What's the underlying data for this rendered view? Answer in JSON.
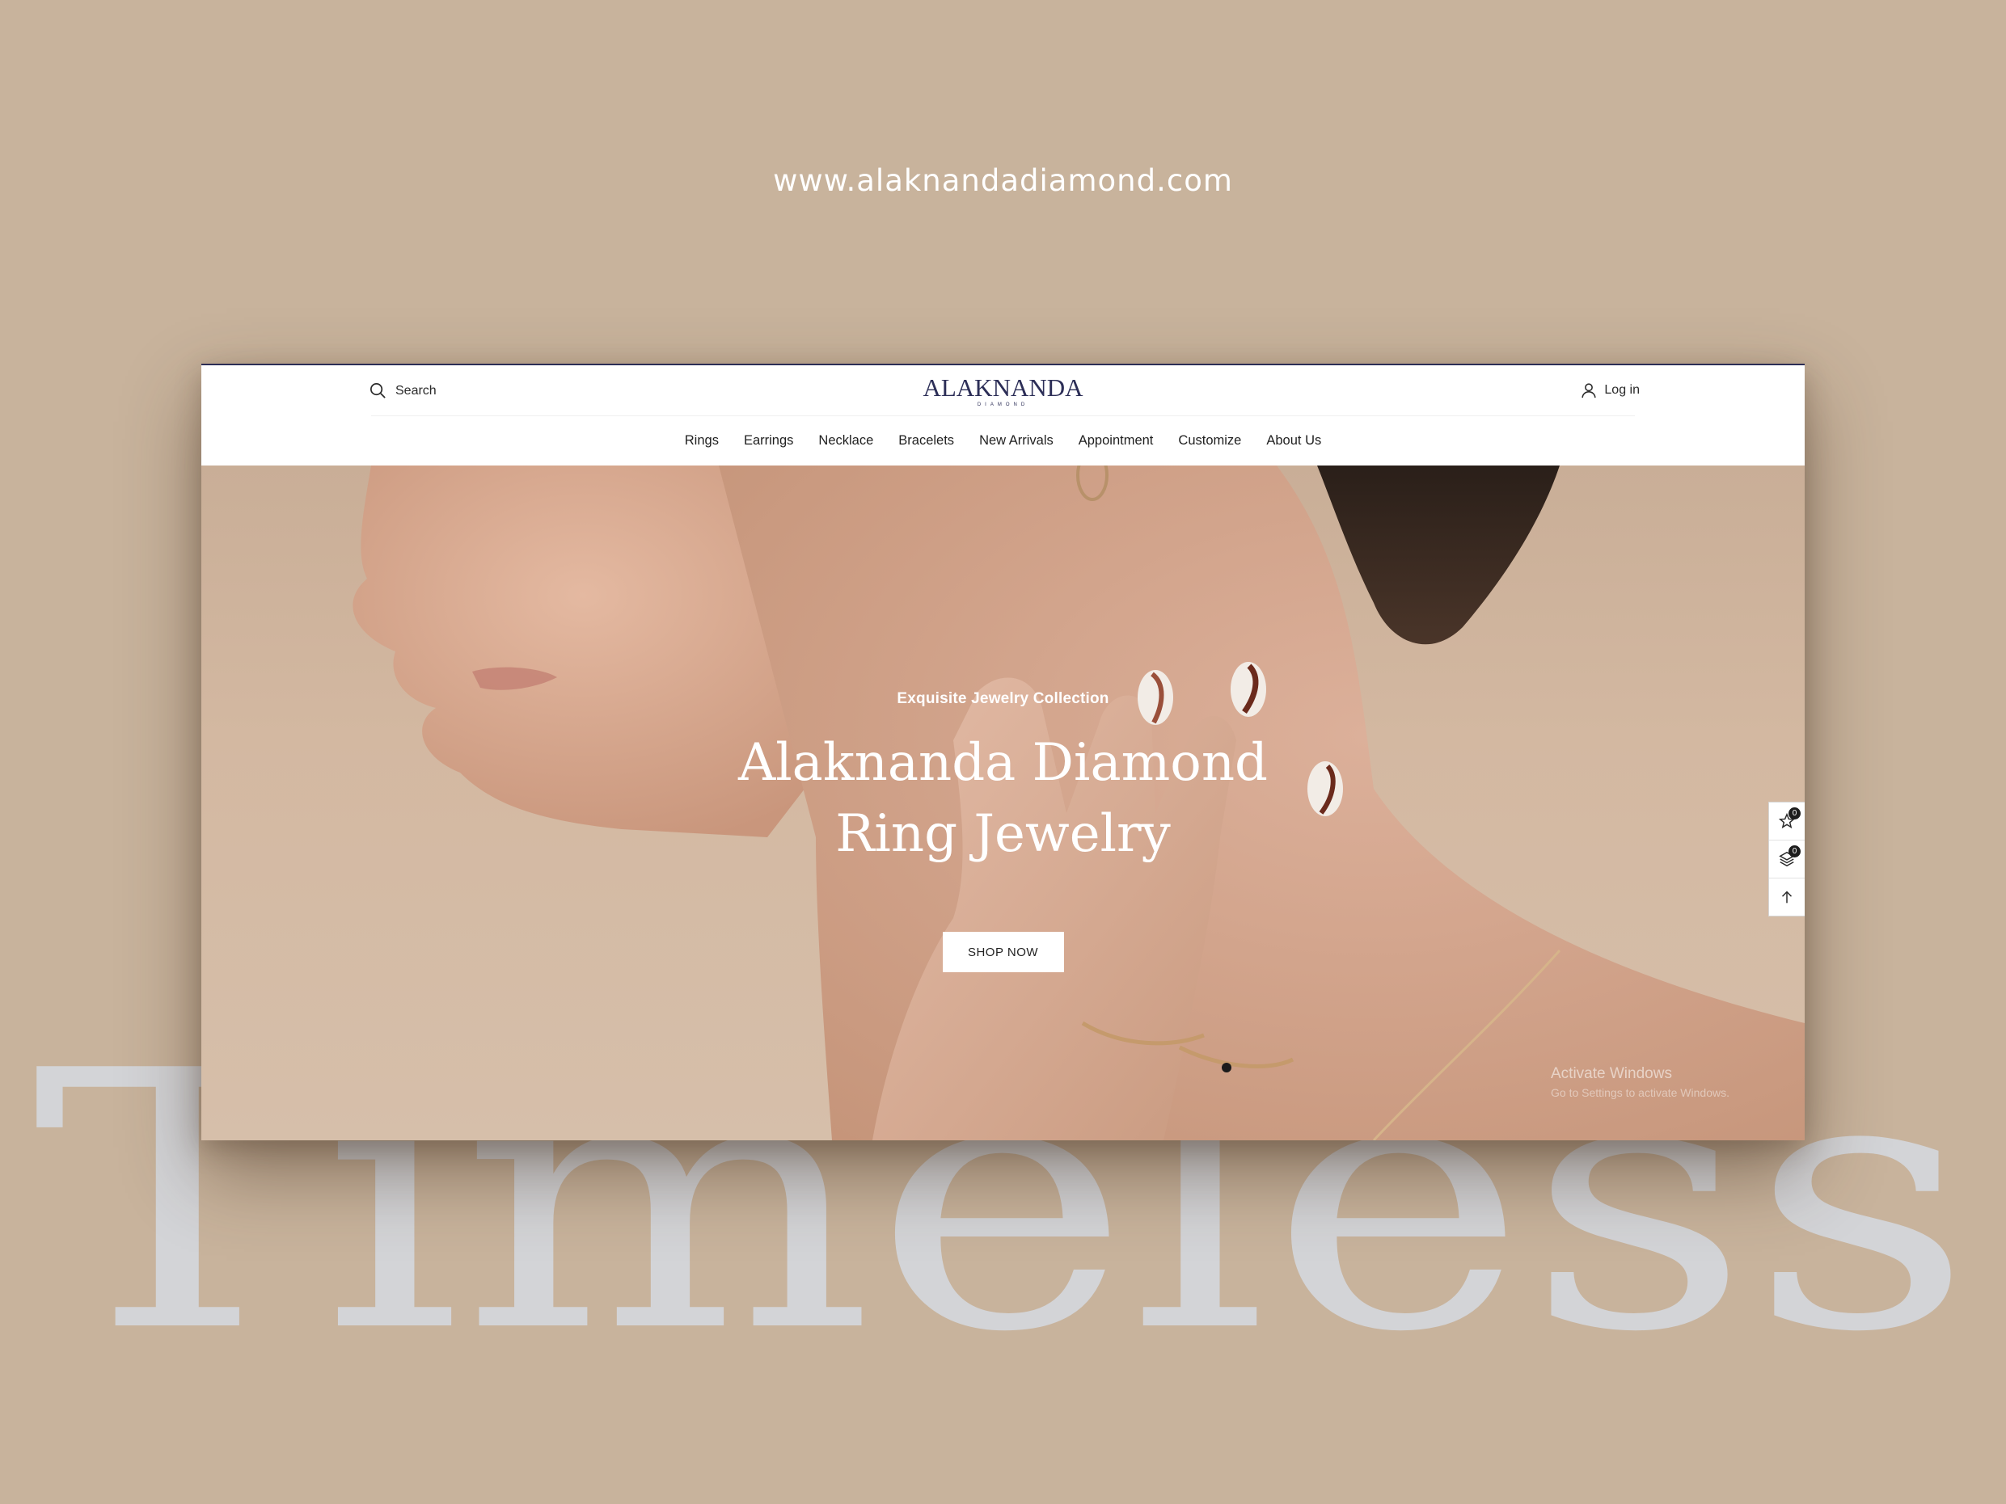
{
  "page": {
    "url": "www.alaknandadiamond.com",
    "background_word": "Timeless",
    "background_color": "#c8b39c"
  },
  "header": {
    "search_label": "Search",
    "logo_main": "ALAKNANDA",
    "logo_sub": "DIAMOND",
    "login_label": "Log in"
  },
  "nav": {
    "items": [
      "Rings",
      "Earrings",
      "Necklace",
      "Bracelets",
      "New Arrivals",
      "Appointment",
      "Customize",
      "About Us"
    ]
  },
  "hero": {
    "eyebrow": "Exquisite Jewelry Collection",
    "title_line1": "Alaknanda Diamond",
    "title_line2": "Ring Jewelry",
    "button": "SHOP NOW"
  },
  "side_tools": {
    "wishlist_count": "0",
    "compare_count": "0",
    "icons": [
      "star-icon",
      "layers-icon",
      "arrow-up-icon"
    ]
  },
  "watermark": {
    "title": "Activate Windows",
    "subtitle": "Go to Settings to activate Windows."
  },
  "colors": {
    "brand": "#2c2e57",
    "hero_text": "#ffffff"
  }
}
